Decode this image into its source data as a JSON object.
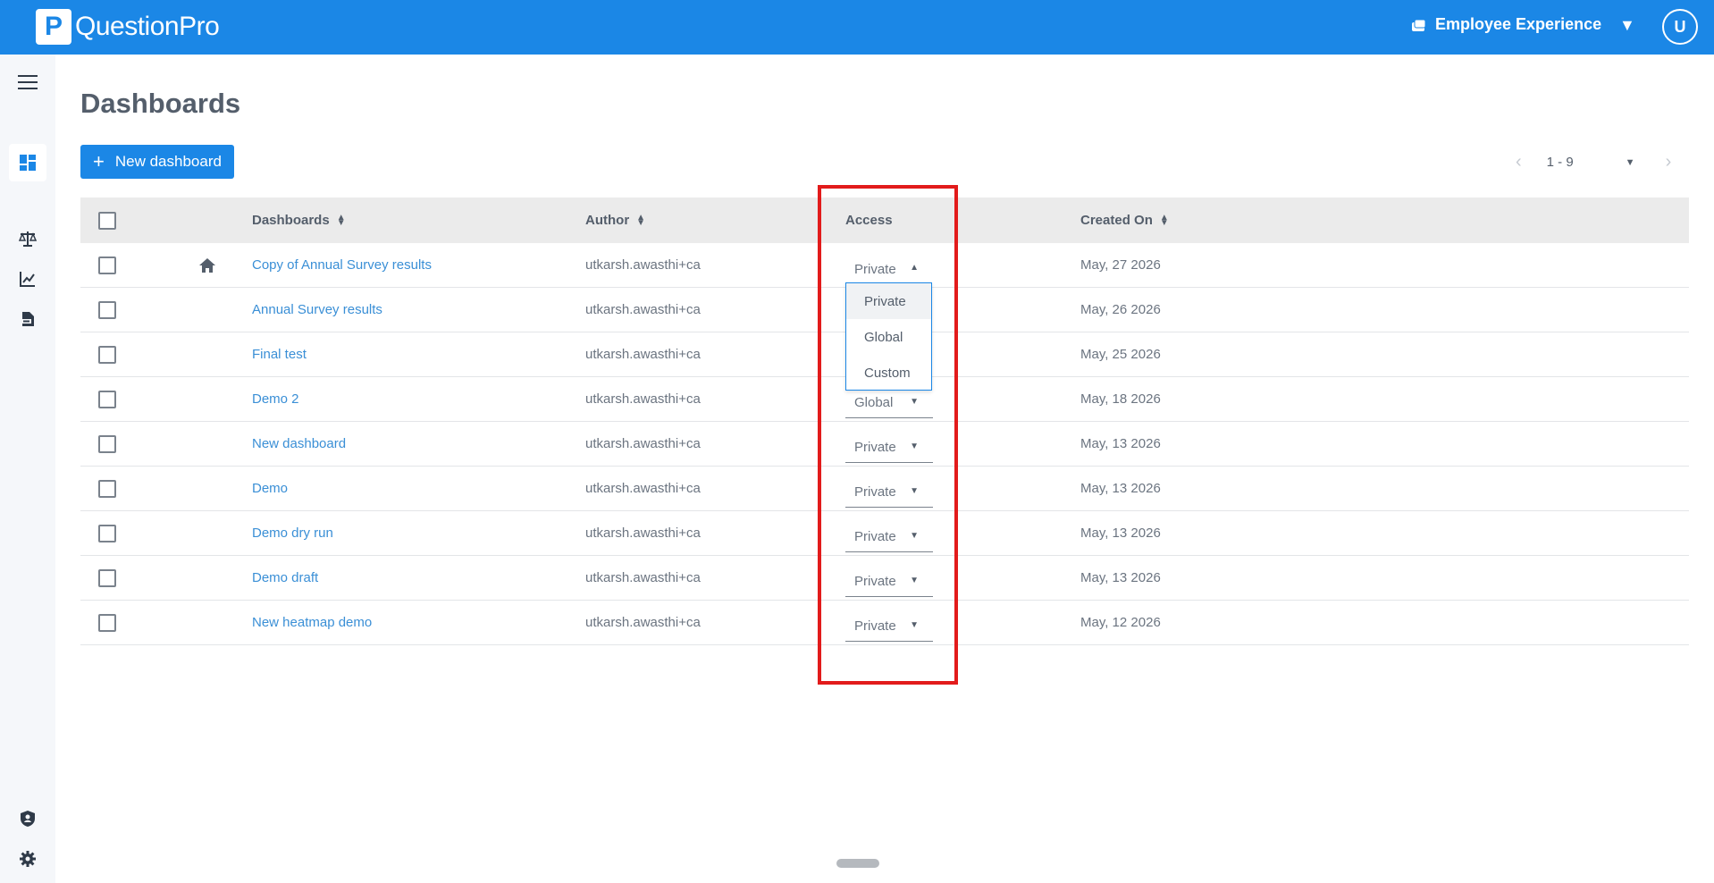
{
  "header": {
    "brand": "QuestionPro",
    "brand_mark": "P",
    "product": "Employee Experience",
    "avatar_initial": "U",
    "accent_color": "#1b87e6"
  },
  "sidebar": {
    "items": [
      {
        "name": "menu",
        "icon": "hamburger-icon"
      },
      {
        "name": "dashboards",
        "icon": "dashboard-icon",
        "active": true
      },
      {
        "name": "benchmark",
        "icon": "scale-icon"
      },
      {
        "name": "analytics",
        "icon": "line-chart-icon"
      },
      {
        "name": "reports",
        "icon": "pdf-icon"
      },
      {
        "name": "admin",
        "icon": "shield-user-icon"
      },
      {
        "name": "settings",
        "icon": "gear-icon"
      }
    ]
  },
  "page": {
    "title": "Dashboards",
    "new_button": "New dashboard",
    "pager": {
      "range": "1 - 9"
    }
  },
  "table": {
    "headers": {
      "dashboards": "Dashboards",
      "author": "Author",
      "access": "Access",
      "created": "Created On"
    },
    "rows": [
      {
        "name": "Copy of Annual Survey results",
        "author": "utkarsh.awasthi+ca",
        "access": "Private",
        "created": "May, 27 2026",
        "home": true,
        "open": true
      },
      {
        "name": "Annual Survey results",
        "author": "utkarsh.awasthi+ca",
        "access": "",
        "created": "May, 26 2026"
      },
      {
        "name": "Final test",
        "author": "utkarsh.awasthi+ca",
        "access": "",
        "created": "May, 25 2026"
      },
      {
        "name": "Demo 2",
        "author": "utkarsh.awasthi+ca",
        "access": "Global",
        "created": "May, 18 2026"
      },
      {
        "name": "New dashboard",
        "author": "utkarsh.awasthi+ca",
        "access": "Private",
        "created": "May, 13 2026"
      },
      {
        "name": "Demo",
        "author": "utkarsh.awasthi+ca",
        "access": "Private",
        "created": "May, 13 2026"
      },
      {
        "name": "Demo dry run",
        "author": "utkarsh.awasthi+ca",
        "access": "Private",
        "created": "May, 13 2026"
      },
      {
        "name": "Demo draft",
        "author": "utkarsh.awasthi+ca",
        "access": "Private",
        "created": "May, 13 2026"
      },
      {
        "name": "New heatmap demo",
        "author": "utkarsh.awasthi+ca",
        "access": "Private",
        "created": "May, 12 2026"
      }
    ]
  },
  "access_menu": {
    "options": [
      "Private",
      "Global",
      "Custom"
    ],
    "selected": "Private"
  },
  "highlight_color": "#e21b1b"
}
